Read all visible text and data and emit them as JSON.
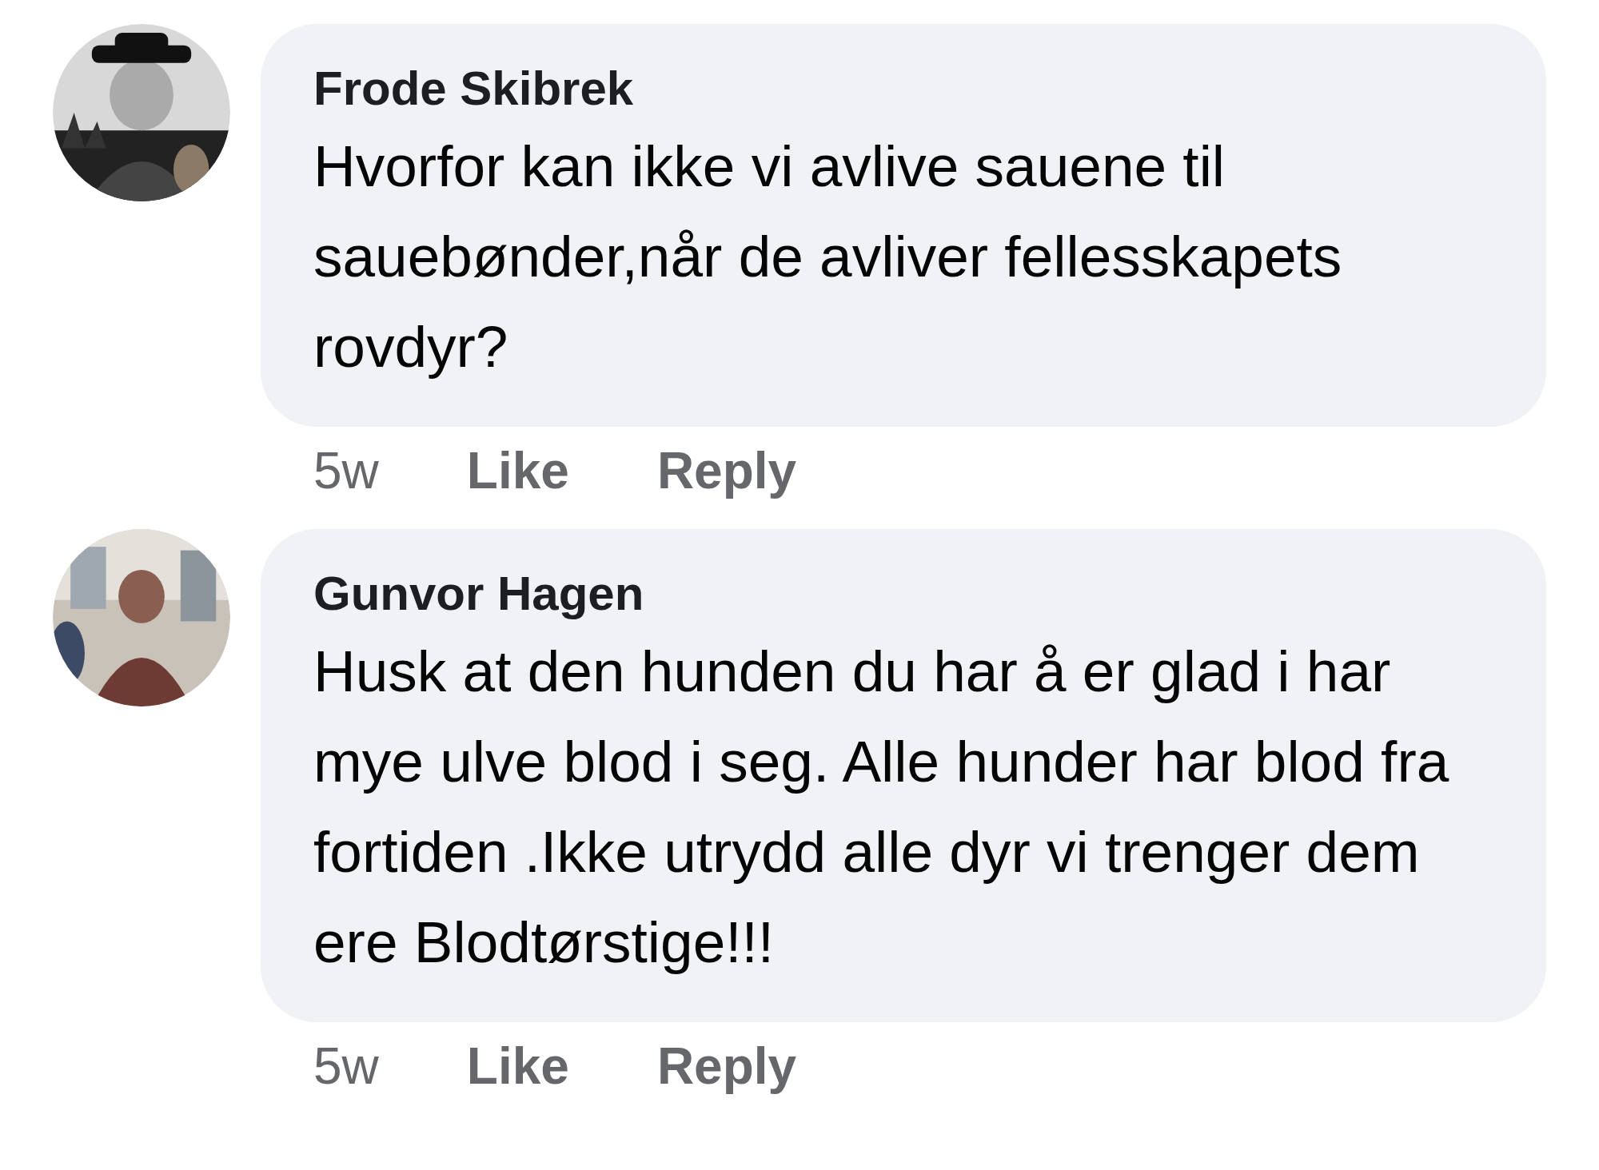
{
  "comments": [
    {
      "author": "Frode Skibrek",
      "text": "Hvorfor kan ikke vi avlive sauene til sauebønder,når de avliver fellesskapets rovdyr?",
      "time": "5w",
      "actions": [
        "Like",
        "Reply"
      ]
    },
    {
      "author": "Gunvor Hagen",
      "text": "Husk at den hunden du har å er glad i har mye ulve blod i seg. Alle hunder har blod fra  fortiden .Ikke utrydd alle dyr vi trenger dem ere Blodtørstige!!!",
      "time": "5w",
      "actions": [
        "Like",
        "Reply"
      ]
    }
  ]
}
